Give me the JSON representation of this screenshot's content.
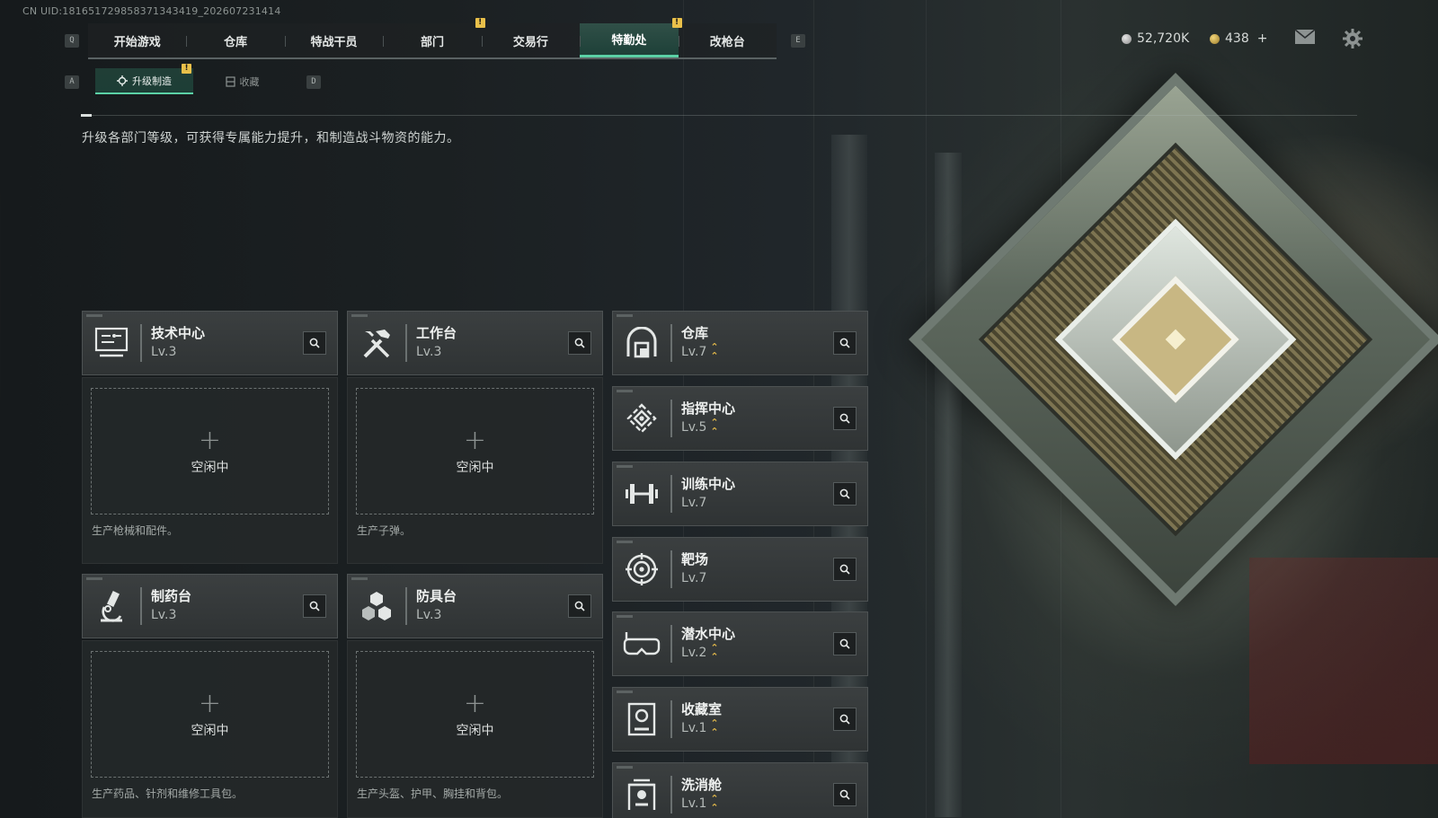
{
  "uid": "CN UID:1816517298583713434​19_202607231414",
  "nav": {
    "left_key": "Q",
    "right_key": "E",
    "tabs": [
      {
        "label": "开始游戏"
      },
      {
        "label": "仓库"
      },
      {
        "label": "特战干员"
      },
      {
        "label": "部门",
        "badge": "!"
      },
      {
        "label": "交易行"
      },
      {
        "label": "特勤处",
        "badge": "!",
        "active": true
      },
      {
        "label": "改枪台"
      }
    ]
  },
  "subnav": {
    "left_key": "A",
    "right_key": "D",
    "tabs": [
      {
        "label": "升级制造",
        "badge": "!",
        "active": true
      },
      {
        "label": "收藏"
      }
    ]
  },
  "currency": {
    "silver": "52,720K",
    "gold": "438",
    "gold_add": "+"
  },
  "description": "升级各部门等级，可获得专属能力提升，和制造战斗物资的能力。",
  "production": [
    {
      "name": "技术中心",
      "level": "Lv.3",
      "icon": "computer-icon",
      "status": "空闲中",
      "note": "生产枪械和配件。"
    },
    {
      "name": "工作台",
      "level": "Lv.3",
      "icon": "tools-icon",
      "status": "空闲中",
      "note": "生产子弹。"
    },
    {
      "name": "制药台",
      "level": "Lv.3",
      "icon": "microscope-icon",
      "status": "空闲中",
      "note": "生产药品、针剂和维修工具包。"
    },
    {
      "name": "防具台",
      "level": "Lv.3",
      "icon": "boxes-icon",
      "status": "空闲中",
      "note": "生产头盔、护甲、胸挂和背包。"
    }
  ],
  "facilities": [
    {
      "name": "仓库",
      "level": "Lv.7",
      "upgradable": true,
      "icon": "vault-icon"
    },
    {
      "name": "指挥中心",
      "level": "Lv.5",
      "upgradable": true,
      "icon": "command-icon"
    },
    {
      "name": "训练中心",
      "level": "Lv.7",
      "upgradable": false,
      "icon": "dumbbell-icon"
    },
    {
      "name": "靶场",
      "level": "Lv.7",
      "upgradable": false,
      "icon": "target-icon"
    },
    {
      "name": "潜水中心",
      "level": "Lv.2",
      "upgradable": true,
      "icon": "goggles-icon"
    },
    {
      "name": "收藏室",
      "level": "Lv.1",
      "upgradable": true,
      "icon": "collection-icon"
    },
    {
      "name": "洗消舱",
      "level": "Lv.1",
      "upgradable": true,
      "icon": "decon-icon"
    }
  ],
  "colors": {
    "accent": "#5bd1a6",
    "badge": "#e9c04a",
    "upgrade_arrow": "#e2b84a",
    "card_header": "#3b3f40"
  }
}
